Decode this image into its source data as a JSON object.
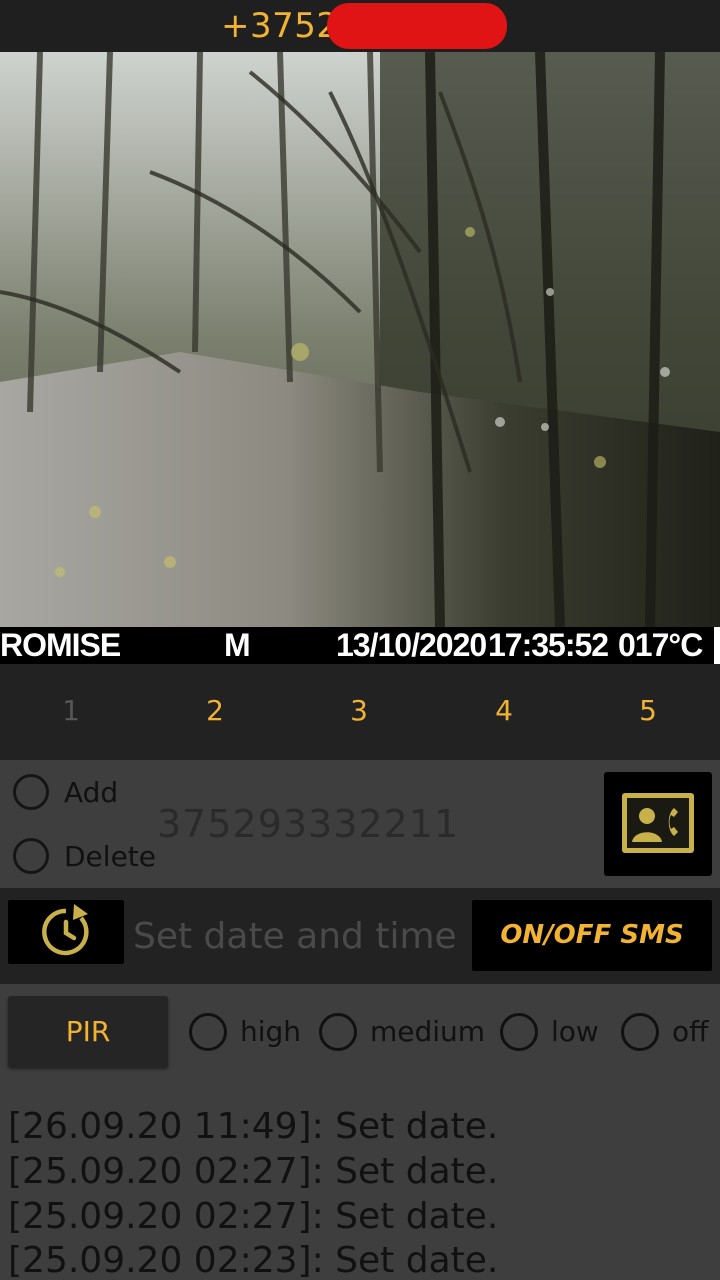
{
  "header": {
    "phone_prefix": "+3752"
  },
  "photo_stamp": {
    "brand": "ROMISE",
    "mode": "M",
    "date": "13/10/2020",
    "time": "17:35:52",
    "temperature": "017°C"
  },
  "tabs": [
    {
      "label": "1",
      "selected": true
    },
    {
      "label": "2",
      "selected": false
    },
    {
      "label": "3",
      "selected": false
    },
    {
      "label": "4",
      "selected": false
    },
    {
      "label": "5",
      "selected": false
    }
  ],
  "contacts": {
    "add_label": "Add",
    "delete_label": "Delete",
    "number": "375293332211",
    "icon": "contact-phone-icon"
  },
  "datetime": {
    "icon": "clock-update-icon",
    "placeholder": "Set date and time",
    "sms_button": "ON/OFF SMS"
  },
  "pir": {
    "button": "PIR",
    "options": [
      "high",
      "medium",
      "low",
      "off"
    ]
  },
  "log": [
    "[26.09.20 11:49]: Set date.",
    "[25.09.20 02:27]: Set date.",
    "[25.09.20 02:27]: Set date.",
    "[25.09.20 02:23]: Set date."
  ],
  "colors": {
    "accent": "#f2b233",
    "redaction": "#e01414"
  }
}
